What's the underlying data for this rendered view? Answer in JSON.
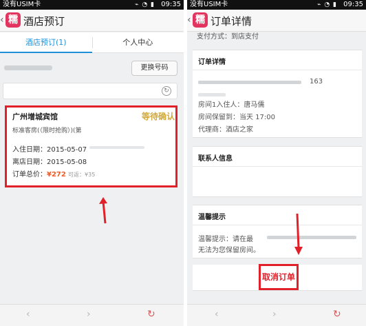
{
  "left": {
    "status_bar": {
      "carrier": "没有USIM卡",
      "time": "09:35"
    },
    "app_logo_char": "糯",
    "title": "酒店预订",
    "tabs": [
      {
        "label": "酒店预订(1)",
        "active": true
      },
      {
        "label": "个人中心",
        "active": false
      }
    ],
    "change_number_label": "更换号码",
    "order": {
      "hotel_name": "广州增城宾馆",
      "room_type": "标准客房(（限时抢购）)(第",
      "status_stamp": "等待确认",
      "checkin_label": "入住日期：",
      "checkin": "2015-05-07",
      "checkout_label": "离店日期：",
      "checkout": "2015-05-08",
      "total_label": "订单总价：",
      "total": "¥272",
      "refund": "可返：¥35"
    }
  },
  "right": {
    "status_bar": {
      "carrier": "没有USIM卡",
      "time": "09:35"
    },
    "title": "订单详情",
    "payment_line": "支付方式：到店支付",
    "order_details": {
      "title": "订单详情",
      "phone_tail": "163",
      "guest": "房间1入住人：唐马儒",
      "hold_until": "房间保留到：当天 17:00",
      "agent": "代理商：酒店之家"
    },
    "contact": {
      "title": "联系人信息"
    },
    "tips": {
      "title": "温馨提示",
      "line1": "温馨提示：请在最",
      "line2": "无法为您保留房间。"
    },
    "cancel_label": "取消订单"
  },
  "colors": {
    "accent_blue": "#1e90d8",
    "highlight_red": "#e2202a",
    "price_orange": "#f05a28",
    "logo_pink": "#e2345f",
    "stamp_gold": "#c89a1a"
  },
  "icons": [
    "back-chevron-icon",
    "app-logo-icon",
    "refresh-icon",
    "arrow-up-icon",
    "nav-back-icon",
    "nav-forward-icon",
    "nav-refresh-icon",
    "arrow-down-icon"
  ]
}
